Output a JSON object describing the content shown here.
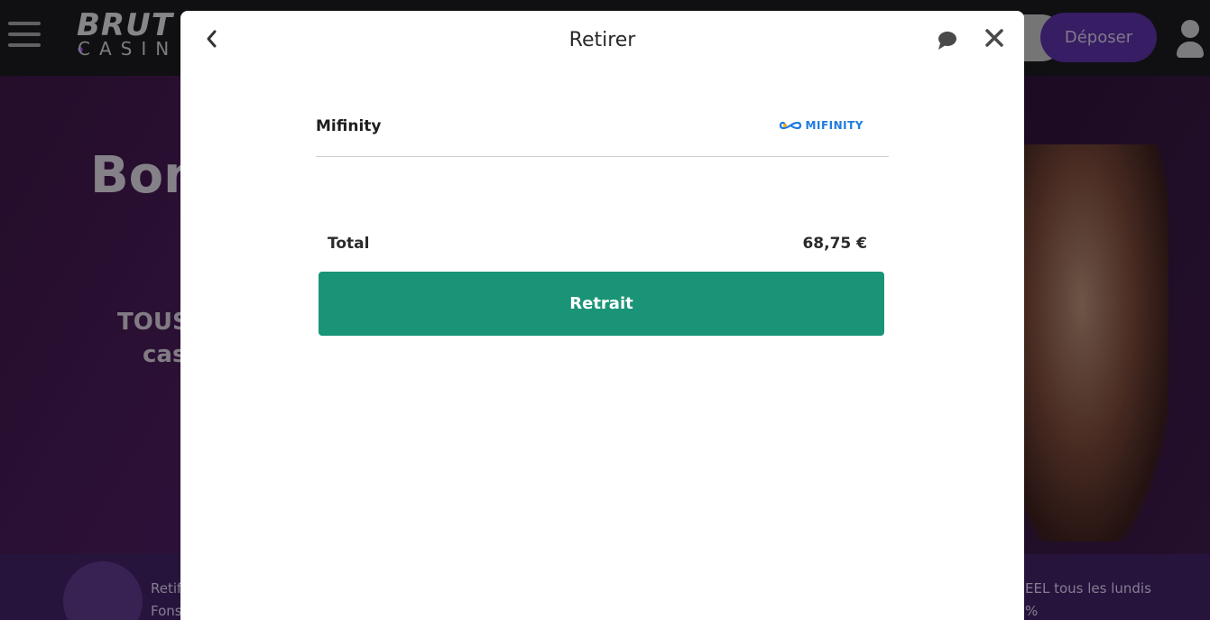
{
  "site": {
    "logo_main": "BRUT",
    "logo_sub": "CASIN",
    "deposit_label": "Déposer",
    "hero_title": "Bon",
    "hero_line1": "TOUS",
    "hero_line2": "cas",
    "promo_left_line1": "Retif",
    "promo_left_line2": "Fons",
    "promo_right_line1": "EEL tous les lundis",
    "promo_right_line2": "%"
  },
  "modal": {
    "title": "Retirer",
    "payment_method": {
      "name": "Mifinity",
      "logo_text": "MIFINITY",
      "logo_icon": "infinity-icon",
      "logo_color": "#1e7be0"
    },
    "total_label": "Total",
    "total_value": "68,75 €",
    "withdraw_label": "Retrait",
    "accent_color": "#1a9477"
  }
}
